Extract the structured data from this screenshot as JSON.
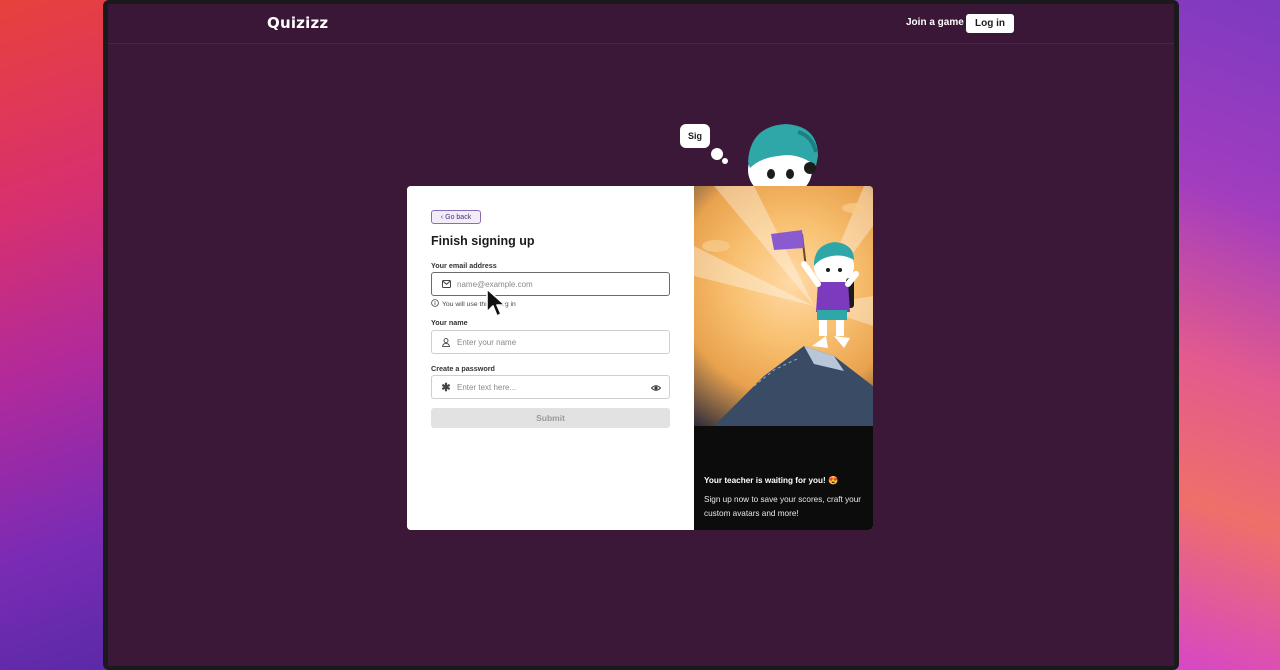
{
  "header": {
    "logo": "Quizizz",
    "join_link": "Join a game",
    "login_button": "Log in"
  },
  "mascot": {
    "thought_text": "Sig"
  },
  "form": {
    "go_back": "Go back",
    "title": "Finish signing up",
    "email_label": "Your email address",
    "email_placeholder": "name@example.com",
    "email_hint": "You will use this to log in",
    "name_label": "Your name",
    "name_placeholder": "Enter your name",
    "password_label": "Create a password",
    "password_placeholder": "Enter text here...",
    "submit": "Submit"
  },
  "promo": {
    "title": "Your teacher is waiting for you! 😍",
    "body": "Sign up now to save your scores, craft your custom avatars and more!"
  },
  "icons": {
    "email": "mail-icon",
    "name": "user-icon",
    "password": "asterisk-icon",
    "reveal": "eye-icon",
    "info": "info-icon",
    "back": "chevron-left-icon"
  },
  "colors": {
    "page_bg": "#3c1838",
    "accent_purple": "#8a6bb5",
    "submit_disabled": "#e2e2e2"
  }
}
